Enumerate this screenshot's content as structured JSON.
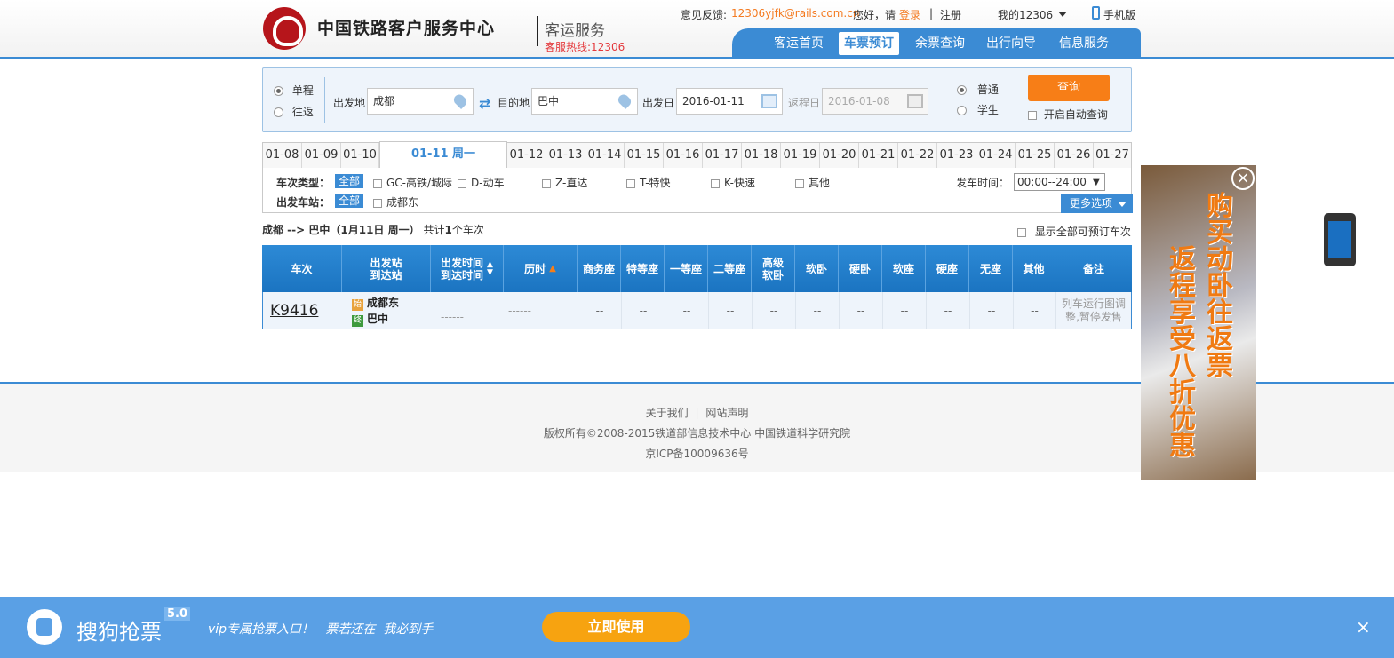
{
  "header": {
    "site_name": "中国铁路客户服务中心",
    "sub_name": "客运服务",
    "hotline": "客服热线:12306",
    "feedback_label": "意见反馈:",
    "feedback_email": "12306yjfk@rails.com.cn",
    "greeting": "您好，请",
    "login": "登录",
    "sep": "|",
    "register": "注册",
    "my12306": "我的12306",
    "mobile": "手机版"
  },
  "nav": [
    "客运首页",
    "车票预订",
    "余票查询",
    "出行向导",
    "信息服务"
  ],
  "search": {
    "trip_oneway": "单程",
    "trip_round": "往返",
    "from_label": "出发地",
    "from_value": "成都",
    "to_label": "目的地",
    "to_value": "巴中",
    "depart_label": "出发日",
    "depart_value": "2016-01-11",
    "return_label": "返程日",
    "return_value": "2016-01-08",
    "type_normal": "普通",
    "type_student": "学生",
    "query": "查询",
    "auto_query": "开启自动查询"
  },
  "date_tabs": [
    "01-08",
    "01-09",
    "01-10",
    "01-11 周一",
    "01-12",
    "01-13",
    "01-14",
    "01-15",
    "01-16",
    "01-17",
    "01-18",
    "01-19",
    "01-20",
    "01-21",
    "01-22",
    "01-23",
    "01-24",
    "01-25",
    "01-26",
    "01-27"
  ],
  "filters": {
    "train_type_label": "车次类型：",
    "all": "全部",
    "types": [
      "GC-高铁/城际",
      "D-动车",
      "Z-直达",
      "T-特快",
      "K-快速",
      "其他"
    ],
    "station_label": "出发车站：",
    "station": "成都东",
    "time_label": "发车时间：",
    "time_value": "00:00--24:00",
    "more": "更多选项"
  },
  "summary": {
    "route": "成都 --> 巴中（1月11日  周一）",
    "count_prefix": "共计",
    "count": "1",
    "count_suffix": "个车次",
    "show_all": "显示全部可预订车次"
  },
  "table": {
    "headers": [
      "车次",
      "出发站\n到达站",
      "出发时间\n到达时间",
      "历时",
      "商务座",
      "特等座",
      "一等座",
      "二等座",
      "高级\n软卧",
      "软卧",
      "硬卧",
      "软座",
      "硬座",
      "无座",
      "其他",
      "备注"
    ],
    "row": {
      "train": "K9416",
      "from_badge": "始",
      "from": "成都东",
      "to_badge": "终",
      "to": "巴中",
      "dep_time": "------",
      "arr_time": "------",
      "duration": "------",
      "seats": [
        "--",
        "--",
        "--",
        "--",
        "--",
        "--",
        "--",
        "--",
        "--",
        "--",
        "--"
      ],
      "note": "列车运行图调整,暂停发售"
    }
  },
  "footer": {
    "about": "关于我们",
    "sep": "|",
    "statement": "网站声明",
    "copyright": "版权所有©2008-2015铁道部信息技术中心   中国铁道科学研究院",
    "icp": "京ICP备10009636号"
  },
  "ad": {
    "line1": "购买动卧往返票",
    "line2": "返程享受八折优惠"
  },
  "bottom_bar": {
    "brand": "搜狗抢票",
    "version": "5.0",
    "slogan": "vip专属抢票入口！   票若还在  我必到手",
    "use_now": "立即使用",
    "close": "×"
  }
}
